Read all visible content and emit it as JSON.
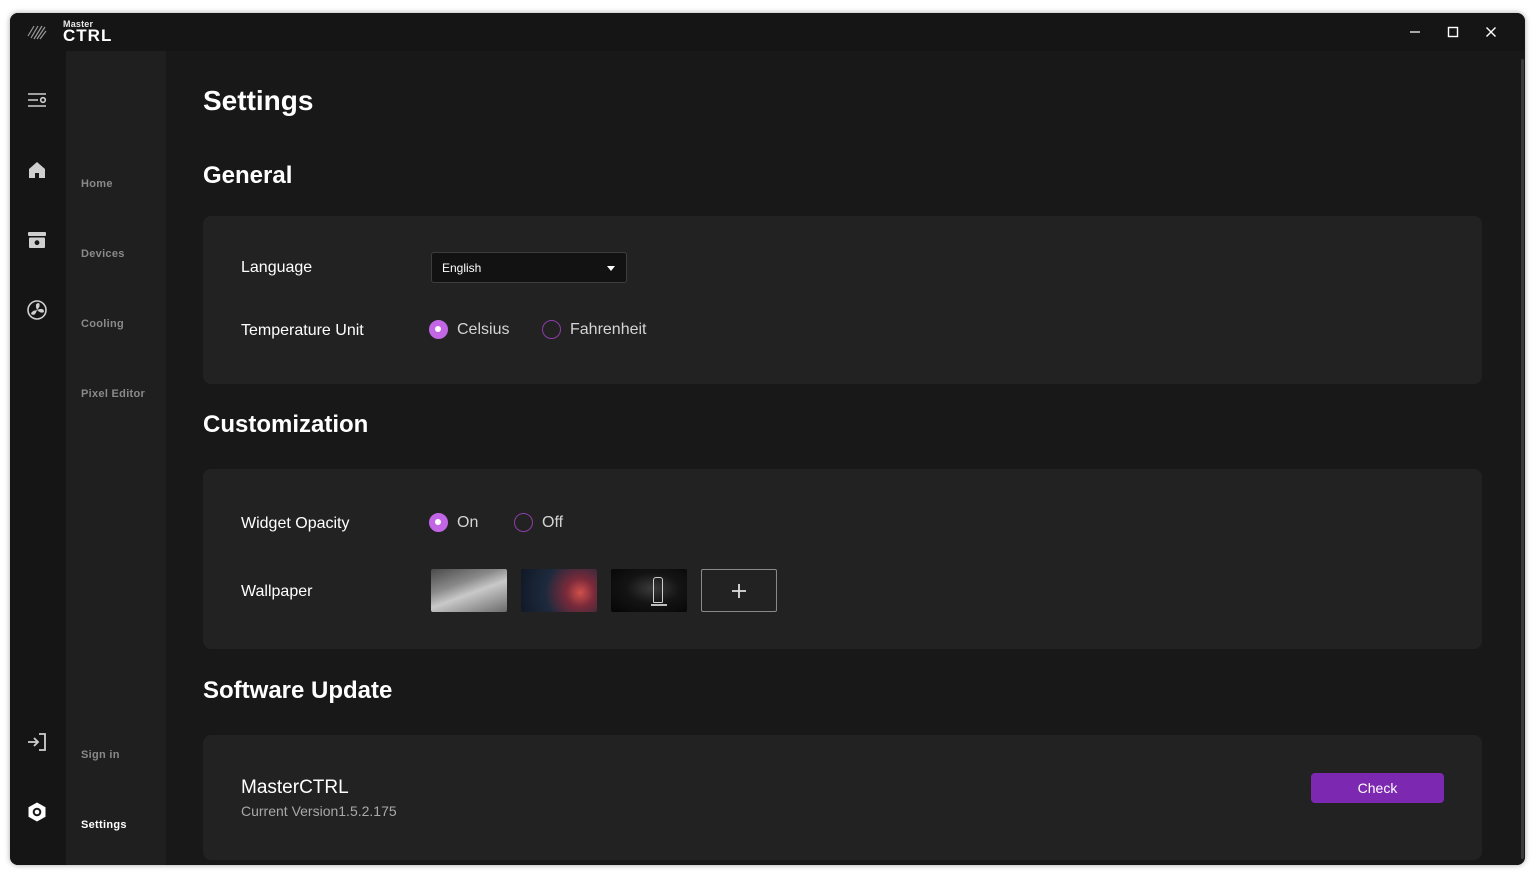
{
  "app": {
    "logo_small": "Master",
    "logo_big": "CTRL",
    "accent_color": "#c266e6",
    "button_color": "#7d28b0"
  },
  "window_controls": [
    "minimize-icon",
    "maximize-icon",
    "close-icon"
  ],
  "sidebar": {
    "items": [
      {
        "label": "Home",
        "icon": "home-icon"
      },
      {
        "label": "Devices",
        "icon": "devices-icon"
      },
      {
        "label": "Cooling",
        "icon": "fan-icon"
      },
      {
        "label": "Pixel Editor",
        "icon": ""
      },
      {
        "label": "Sign in",
        "icon": "sign-in-icon"
      },
      {
        "label": "Settings",
        "icon": "settings-icon",
        "active": true
      }
    ]
  },
  "page": {
    "title": "Settings"
  },
  "general": {
    "heading": "General",
    "language_label": "Language",
    "language_value": "English",
    "temperature_label": "Temperature Unit",
    "temperature_options": [
      "Celsius",
      "Fahrenheit"
    ],
    "temperature_selected": "Celsius"
  },
  "customization": {
    "heading": "Customization",
    "opacity_label": "Widget Opacity",
    "opacity_options": [
      "On",
      "Off"
    ],
    "opacity_selected": "On",
    "wallpaper_label": "Wallpaper"
  },
  "update": {
    "heading": "Software Update",
    "app_name": "MasterCTRL",
    "version_text": "Current Version1.5.2.175",
    "check_label": "Check"
  }
}
